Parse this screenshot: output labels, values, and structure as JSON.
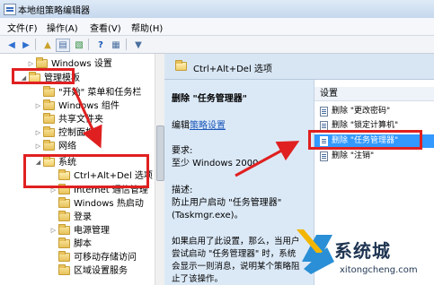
{
  "window": {
    "title": "本地组策略编辑器"
  },
  "menu": [
    "文件(F)",
    "操作(A)",
    "查看(V)",
    "帮助(H)"
  ],
  "toolbar": {
    "buttons": [
      "back-icon",
      "forward-icon",
      "up-folder-icon",
      "show-hide-tree-icon",
      "export-icon",
      "help-icon",
      "properties-icon",
      "filter-icon"
    ]
  },
  "tree": {
    "items": [
      {
        "label": "Windows 设置",
        "expander": "▷"
      },
      {
        "label": "管理模板",
        "expander": "◢"
      },
      {
        "label": "\"开始\" 菜单和任务栏",
        "expander": ""
      },
      {
        "label": "Windows 组件",
        "expander": "▷"
      },
      {
        "label": "共享文件夹",
        "expander": ""
      },
      {
        "label": "控制面板",
        "expander": "▷"
      },
      {
        "label": "网络",
        "expander": "▷"
      },
      {
        "label": "系统",
        "expander": "◢"
      },
      {
        "label": "Ctrl+Alt+Del 选项",
        "expander": ""
      },
      {
        "label": "Internet 通信管理",
        "expander": "▷"
      },
      {
        "label": "Windows 热启动",
        "expander": ""
      },
      {
        "label": "登录",
        "expander": ""
      },
      {
        "label": "电源管理",
        "expander": "▷"
      },
      {
        "label": "脚本",
        "expander": ""
      },
      {
        "label": "可移动存储访问",
        "expander": ""
      },
      {
        "label": "区域设置服务",
        "expander": ""
      }
    ]
  },
  "content": {
    "header": "Ctrl+Alt+Del 选项",
    "description": {
      "title": "删除 \"任务管理器\"",
      "edit_prefix": "编辑",
      "edit_link": "策略设置",
      "requirement_label": "要求:",
      "requirement_value": "至少 Windows 2000",
      "desc_label": "描述:",
      "desc_line1": "防止用户启动 \"任务管理器\"",
      "desc_line2": "(Taskmgr.exe)。",
      "more_line1": "如果启用了此设置，那么，当用户",
      "more_line2": "尝试启动 \"任务管理器\" 时，系统",
      "more_line3": "会显示一则消息，说明某个策略阻",
      "more_line4": "止了该操作。"
    },
    "settings": {
      "header": "设置",
      "items": [
        "删除 \"更改密码\"",
        "删除 \"锁定计算机\"",
        "删除 \"任务管理器\"",
        "删除 \"注销\""
      ],
      "selected_index": 2
    }
  },
  "watermark": {
    "brand": "系统城",
    "url": "xitongcheng.com"
  },
  "colors": {
    "highlight": "#3399ff",
    "annotation": "#e02020",
    "link": "#1a56b8"
  }
}
